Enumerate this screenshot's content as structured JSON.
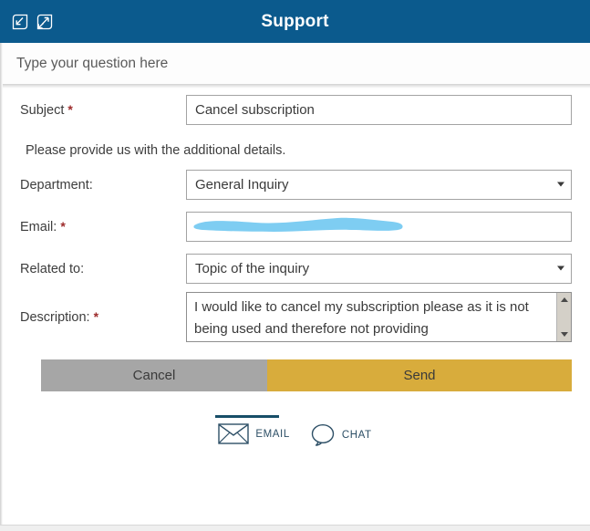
{
  "window": {
    "title": "Support",
    "header_color": "#0b5a8d",
    "icons": [
      {
        "name": "pop-out-icon",
        "label": "Pop out"
      },
      {
        "name": "minimize-icon",
        "label": "Minimize"
      }
    ]
  },
  "question_bar": {
    "placeholder": "Type your question here",
    "value": ""
  },
  "form": {
    "note": "Please provide us with the additional details.",
    "subject": {
      "label": "Subject",
      "required_marker": "*",
      "value": "Cancel subscription"
    },
    "department": {
      "label": "Department:",
      "required_marker": "",
      "value": "General Inquiry",
      "options": [
        "General Inquiry"
      ]
    },
    "email": {
      "label": "Email:",
      "required_marker": "*",
      "value": "",
      "redacted": true,
      "redaction_color": "#7ecdf2"
    },
    "related_to": {
      "label": "Related to:",
      "required_marker": "",
      "value": "Topic of the inquiry",
      "options": [
        "Topic of the inquiry"
      ]
    },
    "description": {
      "label": "Description:",
      "required_marker": "*",
      "value": "I would like to cancel my subscription please as it is not being used and therefore not providing"
    }
  },
  "actions": {
    "cancel_label": "Cancel",
    "cancel_color": "#a6a6a6",
    "send_label": "Send",
    "send_color": "#d8ac3c"
  },
  "footer": {
    "tabs": [
      {
        "label": "EMAIL",
        "icon": "envelope-icon",
        "active": true
      },
      {
        "label": "CHAT",
        "icon": "chat-bubble-icon",
        "active": false
      }
    ],
    "accent_color": "#174e68"
  }
}
